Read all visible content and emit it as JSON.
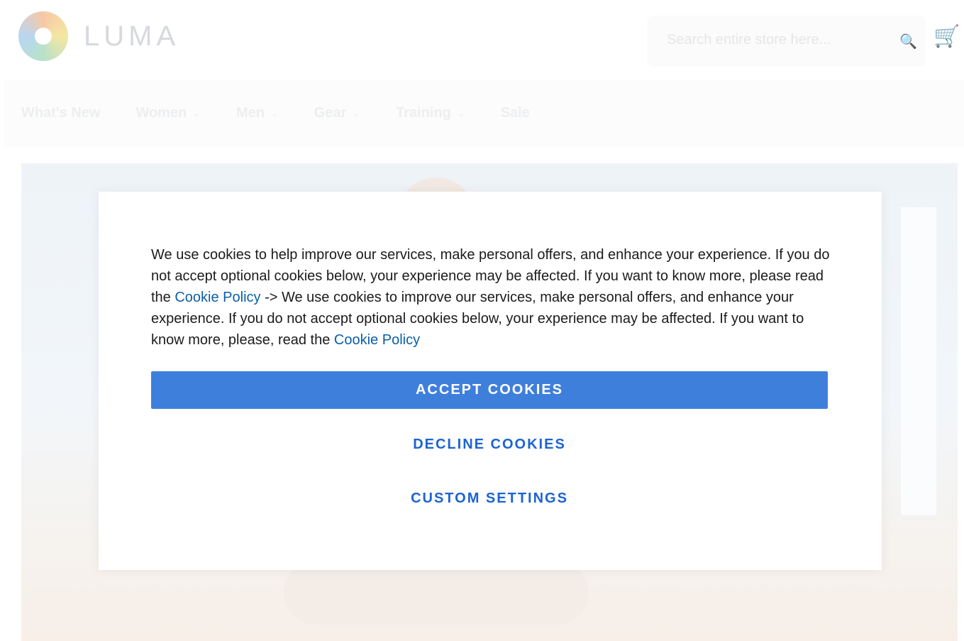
{
  "header": {
    "logo_text": "LUMA",
    "search_placeholder": "Search entire store here...",
    "search_icon": "search-icon",
    "cart_icon": "cart-icon"
  },
  "nav": {
    "items": [
      {
        "label": "What's New",
        "has_dropdown": false
      },
      {
        "label": "Women",
        "has_dropdown": true
      },
      {
        "label": "Men",
        "has_dropdown": true
      },
      {
        "label": "Gear",
        "has_dropdown": true
      },
      {
        "label": "Training",
        "has_dropdown": true
      },
      {
        "label": "Sale",
        "has_dropdown": false
      }
    ]
  },
  "cookie_modal": {
    "text_part1": "We use cookies to help improve our services, make personal offers, and enhance your experience. If you do not accept optional cookies below, your experience may be affected. If you want to know more, please read the ",
    "link1": "Cookie Policy",
    "text_part2": " -> We use cookies to improve our services, make personal offers, and enhance your experience. If you do not accept optional cookies below, your experience may be affected. If you want to know more, please, read the ",
    "link2": "Cookie Policy",
    "accept_label": "ACCEPT COOKIES",
    "decline_label": "DECLINE COOKIES",
    "custom_label": "CUSTOM SETTINGS"
  },
  "colors": {
    "accent": "#3f7fdc",
    "link": "#0b5fa8",
    "secondary_button_text": "#1d63d1"
  }
}
